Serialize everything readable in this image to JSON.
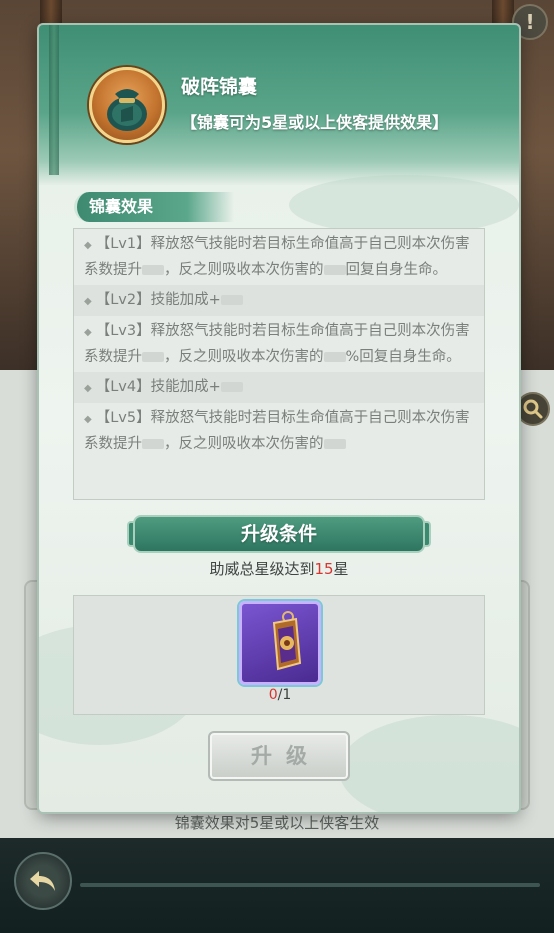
{
  "modal": {
    "item_name": "破阵锦囊",
    "item_subtitle": "【锦囊可为5星或以上侠客提供效果】",
    "effects_section": "锦囊效果",
    "effects": [
      {
        "text": "【Lv1】释放怒气技能时若目标生命值高于自己则本次伤害系数提升",
        "mid": "，反之则吸收本次伤害的",
        "tail": "回复自身生命。"
      },
      {
        "text": "【Lv2】技能加成+",
        "mid": "",
        "tail": ""
      },
      {
        "text": "【Lv3】释放怒气技能时若目标生命值高于自己则本次伤害系数提升",
        "mid": "，反之则吸收本次伤害的",
        "tail": "%回复自身生命。"
      },
      {
        "text": "【Lv4】技能加成+",
        "mid": "",
        "tail": ""
      },
      {
        "text": "【Lv5】释放怒气技能时若目标生命值高于自己则本次伤害系数提升",
        "mid": "，反之则吸收本次伤害的",
        "tail": ""
      }
    ],
    "upgrade_section": "升级条件",
    "condition_prefix": "助威总星级达到",
    "condition_value": "15",
    "condition_suffix": "星",
    "required_item": {
      "have": "0",
      "need": "/1",
      "icon": "bronze-token-icon"
    },
    "upgrade_button": "升级"
  },
  "background": {
    "footer_note": "锦囊效果对5星或以上侠客生效",
    "warn_icon": "!"
  }
}
